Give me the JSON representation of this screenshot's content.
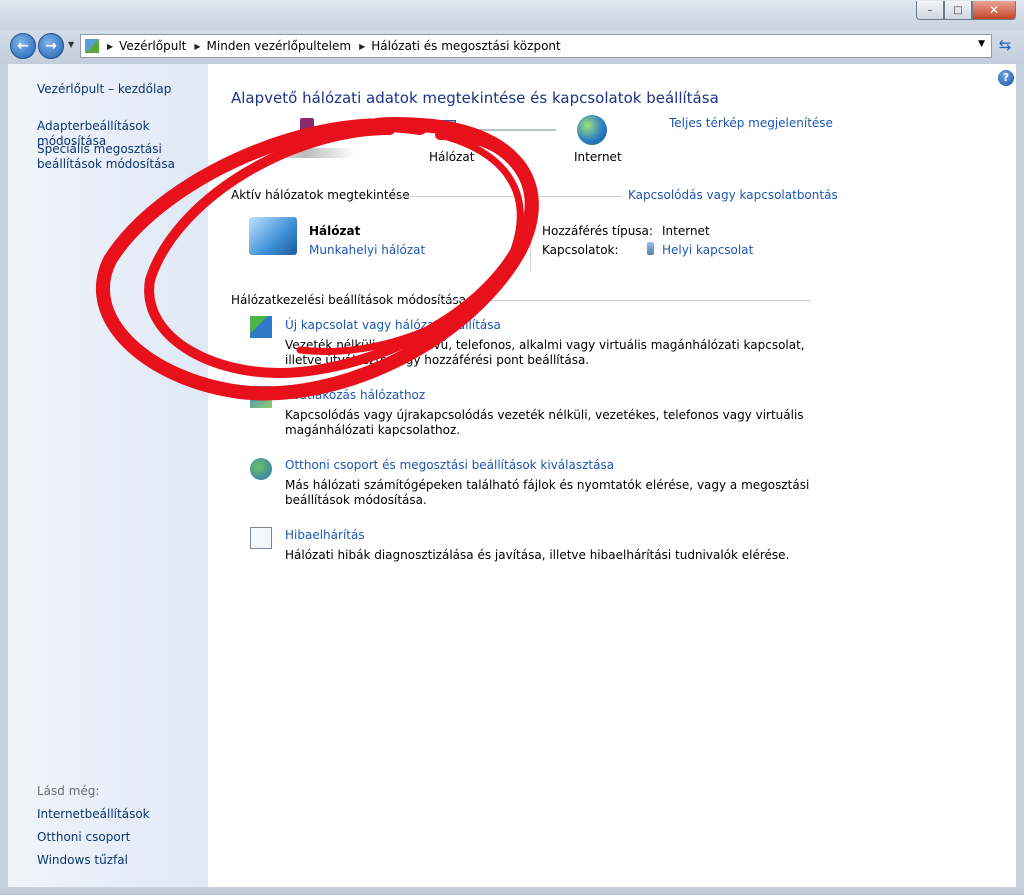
{
  "titlebar": {
    "minimize_icon": "minimize-icon",
    "maximize_icon": "maximize-icon",
    "close_icon": "close-icon"
  },
  "address_bar": {
    "breadcrumbs": [
      "Vezérlőpult",
      "Minden vezérlőpultelem",
      "Hálózati és megosztási központ"
    ]
  },
  "left_pane": {
    "home_link": "Vezérlőpult – kezdőlap",
    "links": [
      "Adapterbeállítások módosítása",
      "Speciális megosztási beállítások módosítása"
    ],
    "see_also_heading": "Lásd még:",
    "see_also": [
      "Internetbeállítások",
      "Otthoni csoport",
      "Windows tűzfal"
    ]
  },
  "main": {
    "title": "Alapvető hálózati adatok megtekintése és kapcsolatok beállítása",
    "full_map_link": "Teljes térkép megjelenítése",
    "map": {
      "network_label": "Hálózat",
      "internet_label": "Internet"
    },
    "active_networks": {
      "heading": "Aktív hálózatok megtekintése",
      "connect_link": "Kapcsolódás vagy kapcsolatbontás",
      "network_name": "Hálózat",
      "network_type": "Munkahelyi hálózat",
      "access_type_label": "Hozzáférés típusa:",
      "access_type_value": "Internet",
      "connections_label": "Kapcsolatok:",
      "connections_value": "Helyi kapcsolat"
    },
    "settings": {
      "heading": "Hálózatkezelési beállítások módosítása",
      "tasks": [
        {
          "title": "Új kapcsolat vagy hálózat beállítása",
          "desc": "Vezeték nélküli, szélessávú, telefonos, alkalmi vagy virtuális magánhálózati kapcsolat, illetve útválasztó vagy hozzáférési pont beállítása."
        },
        {
          "title": "Csatlakozás hálózathoz",
          "desc": "Kapcsolódás vagy újrakapcsolódás vezeték nélküli, vezetékes, telefonos vagy virtuális magánhálózati kapcsolathoz."
        },
        {
          "title": "Otthoni csoport és megosztási beállítások kiválasztása",
          "desc": "Más hálózati számítógépeken található fájlok és nyomtatók elérése, vagy a megosztási beállítások módosítása."
        },
        {
          "title": "Hibaelhárítás",
          "desc": "Hálózati hibák diagnosztizálása és javítása, illetve hibaelhárítási tudnivalók elérése."
        }
      ]
    }
  },
  "colors": {
    "link": "#1c57b3",
    "title": "#1e3287",
    "scribble": "#e8101a"
  }
}
